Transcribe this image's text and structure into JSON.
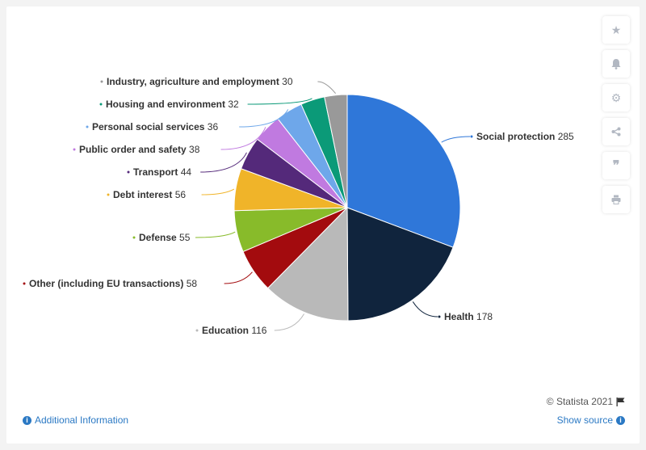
{
  "chart_data": {
    "type": "pie",
    "slices": [
      {
        "label": "Social protection",
        "value": 285,
        "color": "#2f77d9"
      },
      {
        "label": "Health",
        "value": 178,
        "color": "#10243d"
      },
      {
        "label": "Education",
        "value": 116,
        "color": "#b9b9b9"
      },
      {
        "label": "Other (including EU transactions)",
        "value": 58,
        "color": "#a30b0e"
      },
      {
        "label": "Defense",
        "value": 55,
        "color": "#88bb2a"
      },
      {
        "label": "Debt interest",
        "value": 56,
        "color": "#f0b429"
      },
      {
        "label": "Transport",
        "value": 44,
        "color": "#54297a"
      },
      {
        "label": "Public order and safety",
        "value": 38,
        "color": "#c07ae0"
      },
      {
        "label": "Personal social services",
        "value": 36,
        "color": "#6ea7ea"
      },
      {
        "label": "Housing and environment",
        "value": 32,
        "color": "#0b9a78"
      },
      {
        "label": "Industry, agriculture and employment",
        "value": 30,
        "color": "#999999"
      }
    ]
  },
  "toolbar": {
    "icons": [
      "star-icon",
      "bell-icon",
      "gear-icon",
      "share-icon",
      "quote-icon",
      "print-icon"
    ]
  },
  "footer": {
    "credit": "© Statista 2021",
    "additional_info": "Additional Information",
    "show_source": "Show source"
  }
}
